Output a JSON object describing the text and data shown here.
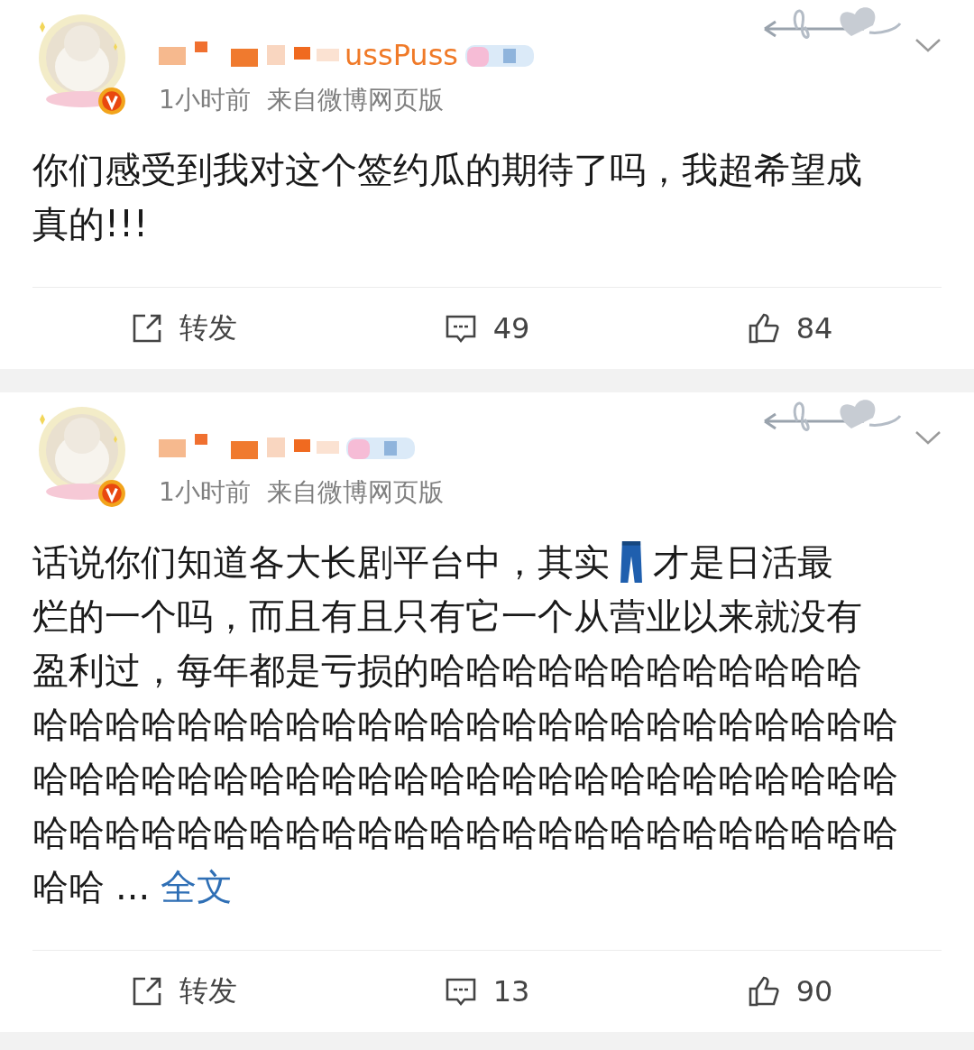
{
  "posts": [
    {
      "name": "ussPuss",
      "time": "1小时前",
      "source": "来自微博网页版",
      "lines": [
        [
          {
            "kind": "text",
            "text": "你们感受到我对这个签约瓜的期待了吗，我超希望成"
          }
        ],
        [
          {
            "kind": "text",
            "text": "真的!!!"
          }
        ]
      ],
      "repost": "转发",
      "comments": "49",
      "likes": "84"
    },
    {
      "time": "1小时前",
      "source": "来自微博网页版",
      "lines": [
        [
          {
            "kind": "text",
            "text": "话说你们知道各大长剧平台中，其实"
          },
          {
            "kind": "jeans"
          },
          {
            "kind": "text",
            "text": "才是日活最"
          }
        ],
        [
          {
            "kind": "text",
            "text": "烂的一个吗，而且有且只有它一个从营业以来就没有"
          }
        ],
        [
          {
            "kind": "text",
            "text": "盈利过，每年都是亏损的哈哈哈哈哈哈哈哈哈哈哈哈"
          }
        ],
        [
          {
            "kind": "text",
            "text": "哈哈哈哈哈哈哈哈哈哈哈哈哈哈哈哈哈哈哈哈哈哈哈哈"
          }
        ],
        [
          {
            "kind": "text",
            "text": "哈哈哈哈哈哈哈哈哈哈哈哈哈哈哈哈哈哈哈哈哈哈哈哈"
          }
        ],
        [
          {
            "kind": "text",
            "text": "哈哈哈哈哈哈哈哈哈哈哈哈哈哈哈哈哈哈哈哈哈哈哈哈"
          }
        ],
        [
          {
            "kind": "text",
            "text": "哈哈"
          },
          {
            "kind": "ellipsis",
            "text": "..."
          },
          {
            "kind": "more",
            "text": "全文"
          }
        ]
      ],
      "repost": "转发",
      "comments": "13",
      "likes": "90"
    }
  ]
}
